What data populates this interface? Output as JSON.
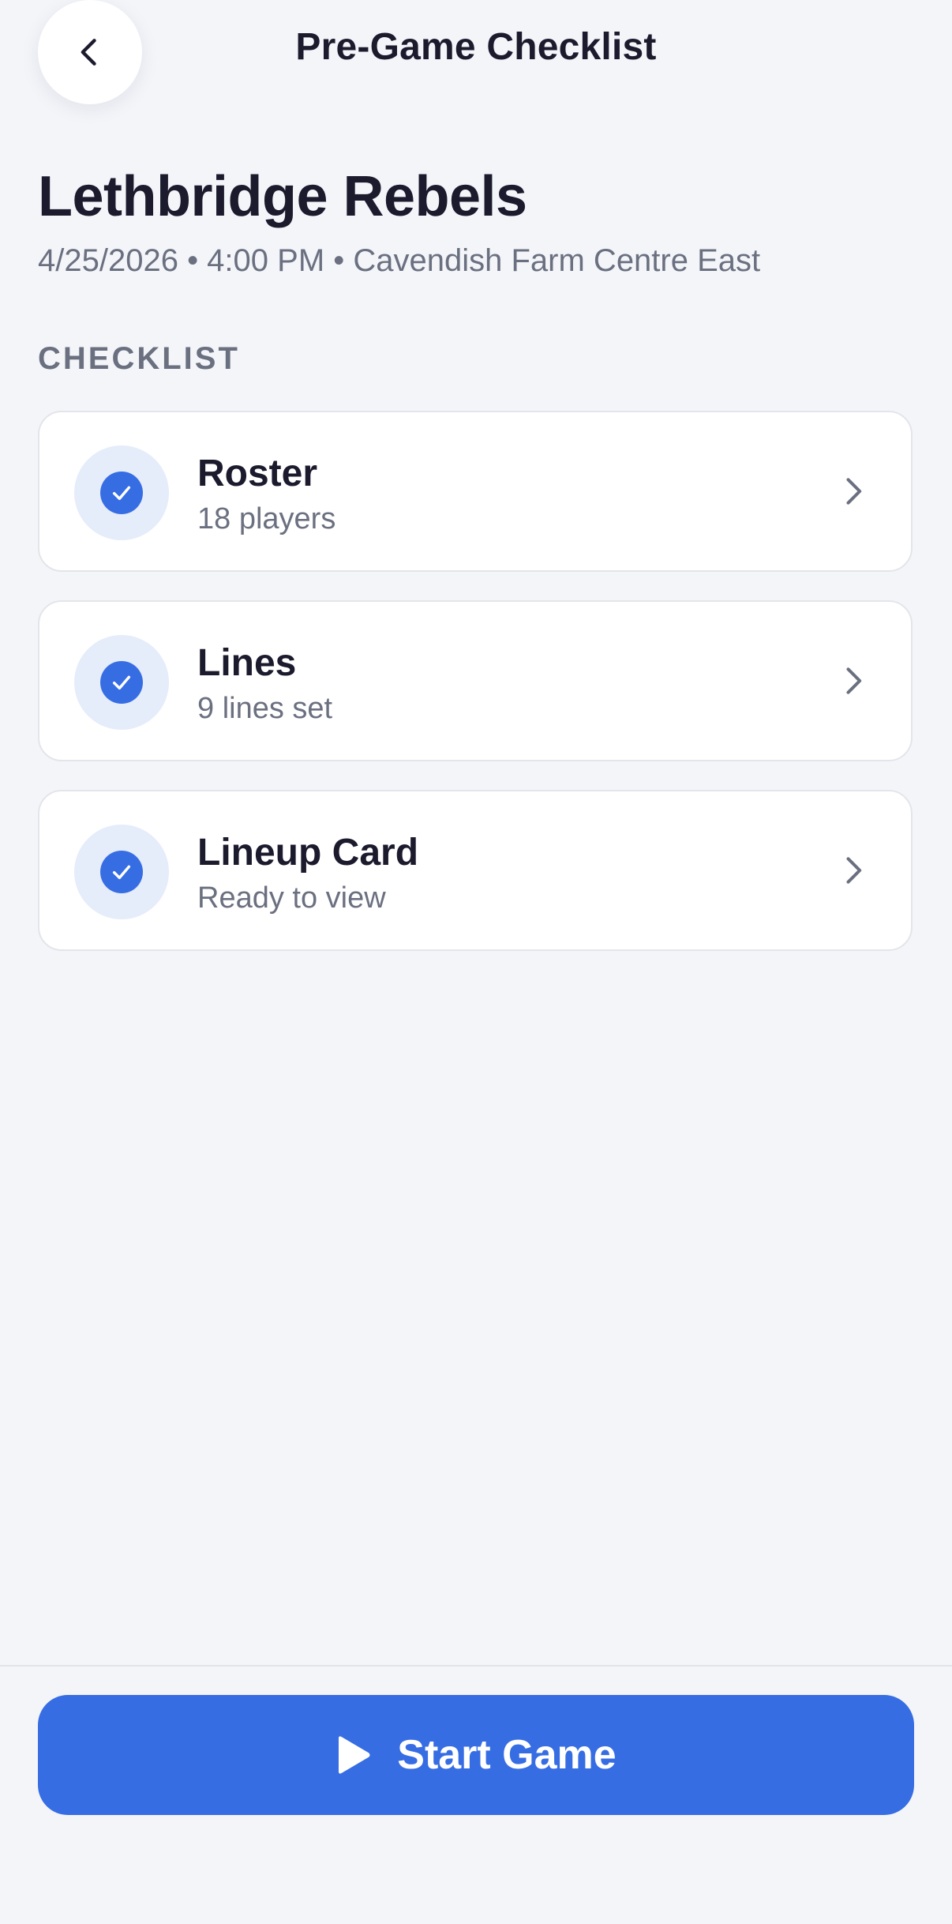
{
  "header": {
    "back_icon": "chevron-left-icon",
    "title": "Pre-Game Checklist"
  },
  "game": {
    "team": "Lethbridge Rebels",
    "meta": "4/25/2026 • 4:00 PM • Cavendish Farm Centre East"
  },
  "checklist": {
    "section_label": "CHECKLIST",
    "items": [
      {
        "title": "Roster",
        "subtitle": "18 players",
        "status": "complete",
        "status_icon": "checkmark-icon",
        "arrow_icon": "chevron-right-icon"
      },
      {
        "title": "Lines",
        "subtitle": "9 lines set",
        "status": "complete",
        "status_icon": "checkmark-icon",
        "arrow_icon": "chevron-right-icon"
      },
      {
        "title": "Lineup Card",
        "subtitle": "Ready to view",
        "status": "complete",
        "status_icon": "checkmark-icon",
        "arrow_icon": "chevron-right-icon"
      }
    ]
  },
  "footer": {
    "start_label": "Start Game",
    "start_icon": "play-icon"
  },
  "colors": {
    "accent": "#376de3",
    "background": "#f3f5f9",
    "card": "#ffffff",
    "text_primary": "#1c1b2e",
    "text_secondary": "#6b7080",
    "check_bg": "#e5ecfa"
  }
}
